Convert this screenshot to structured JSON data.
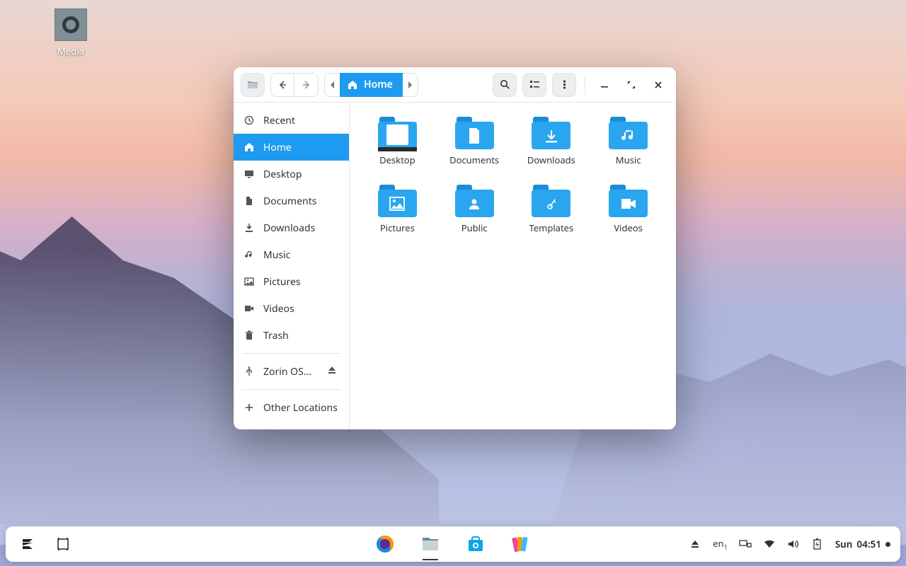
{
  "desktop": {
    "icons": [
      {
        "name": "media",
        "label": "Media"
      }
    ]
  },
  "window": {
    "pathbar": {
      "current": "Home"
    },
    "sidebar": {
      "sections": [
        [
          {
            "icon": "clock",
            "label": "Recent"
          },
          {
            "icon": "home",
            "label": "Home",
            "active": true
          },
          {
            "icon": "desktop",
            "label": "Desktop"
          },
          {
            "icon": "document",
            "label": "Documents"
          },
          {
            "icon": "download",
            "label": "Downloads"
          },
          {
            "icon": "music",
            "label": "Music"
          },
          {
            "icon": "picture",
            "label": "Pictures"
          },
          {
            "icon": "video",
            "label": "Videos"
          },
          {
            "icon": "trash",
            "label": "Trash"
          }
        ],
        [
          {
            "icon": "usb",
            "label": "Zorin OS...",
            "eject": true
          }
        ],
        [
          {
            "icon": "plus",
            "label": "Other Locations"
          }
        ]
      ]
    },
    "folders": [
      {
        "label": "Desktop",
        "glyph": "desktop"
      },
      {
        "label": "Documents",
        "glyph": "document"
      },
      {
        "label": "Downloads",
        "glyph": "download"
      },
      {
        "label": "Music",
        "glyph": "music"
      },
      {
        "label": "Pictures",
        "glyph": "picture"
      },
      {
        "label": "Public",
        "glyph": "public"
      },
      {
        "label": "Templates",
        "glyph": "templates"
      },
      {
        "label": "Videos",
        "glyph": "video"
      }
    ]
  },
  "taskbar": {
    "lang": "en",
    "lang_sub": "1",
    "day": "Sun",
    "time": "04:51"
  }
}
